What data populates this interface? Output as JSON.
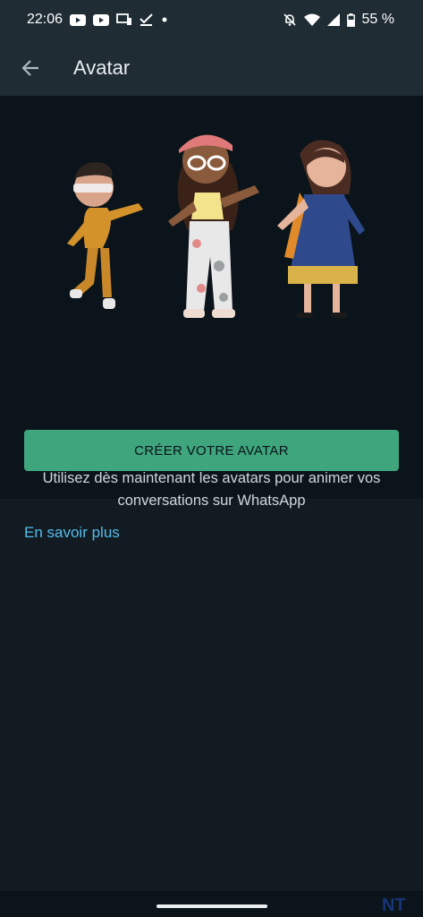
{
  "status_bar": {
    "time": "22:06",
    "battery_text": "55 %",
    "left_icons": [
      "youtube-icon",
      "youtube-icon",
      "cast-icon",
      "check-icon",
      "dot-icon"
    ],
    "right_icons": [
      "notifications-off-icon",
      "wifi-icon",
      "signal-icon",
      "battery-icon"
    ]
  },
  "header": {
    "title": "Avatar",
    "back_icon": "arrow-back-icon"
  },
  "hero": {
    "illustration": "three-avatars-dancing",
    "description_line1": "Utilisez dès maintenant les avatars pour animer vos",
    "description_line2": "conversations sur WhatsApp",
    "cta_label": "CRÉER VOTRE AVATAR"
  },
  "links": {
    "learn_more": "En savoir plus"
  },
  "watermark": "NT",
  "colors": {
    "background": "#121b22",
    "header": "#1f2c34",
    "hero": "#0b141a",
    "accent": "#3ea57c",
    "link": "#53bdeb"
  }
}
